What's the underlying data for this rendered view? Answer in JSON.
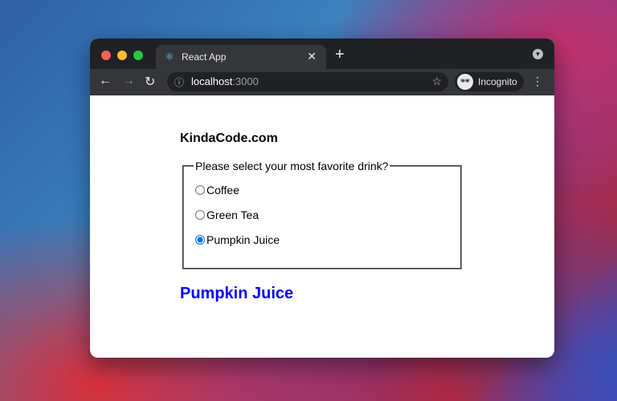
{
  "browser": {
    "tab": {
      "title": "React App",
      "favicon": "react-icon"
    },
    "address": {
      "host": "localhost",
      "port": ":3000"
    },
    "profile": "Incognito"
  },
  "page": {
    "brand": "KindaCode.com",
    "question": "Please select your most favorite drink?",
    "options": [
      {
        "label": "Coffee",
        "checked": false
      },
      {
        "label": "Green Tea",
        "checked": false
      },
      {
        "label": "Pumpkin Juice",
        "checked": true
      }
    ],
    "selected": "Pumpkin Juice",
    "colors": {
      "selected_text": "#0000ff",
      "radio_accent": "#0a6cff"
    }
  }
}
